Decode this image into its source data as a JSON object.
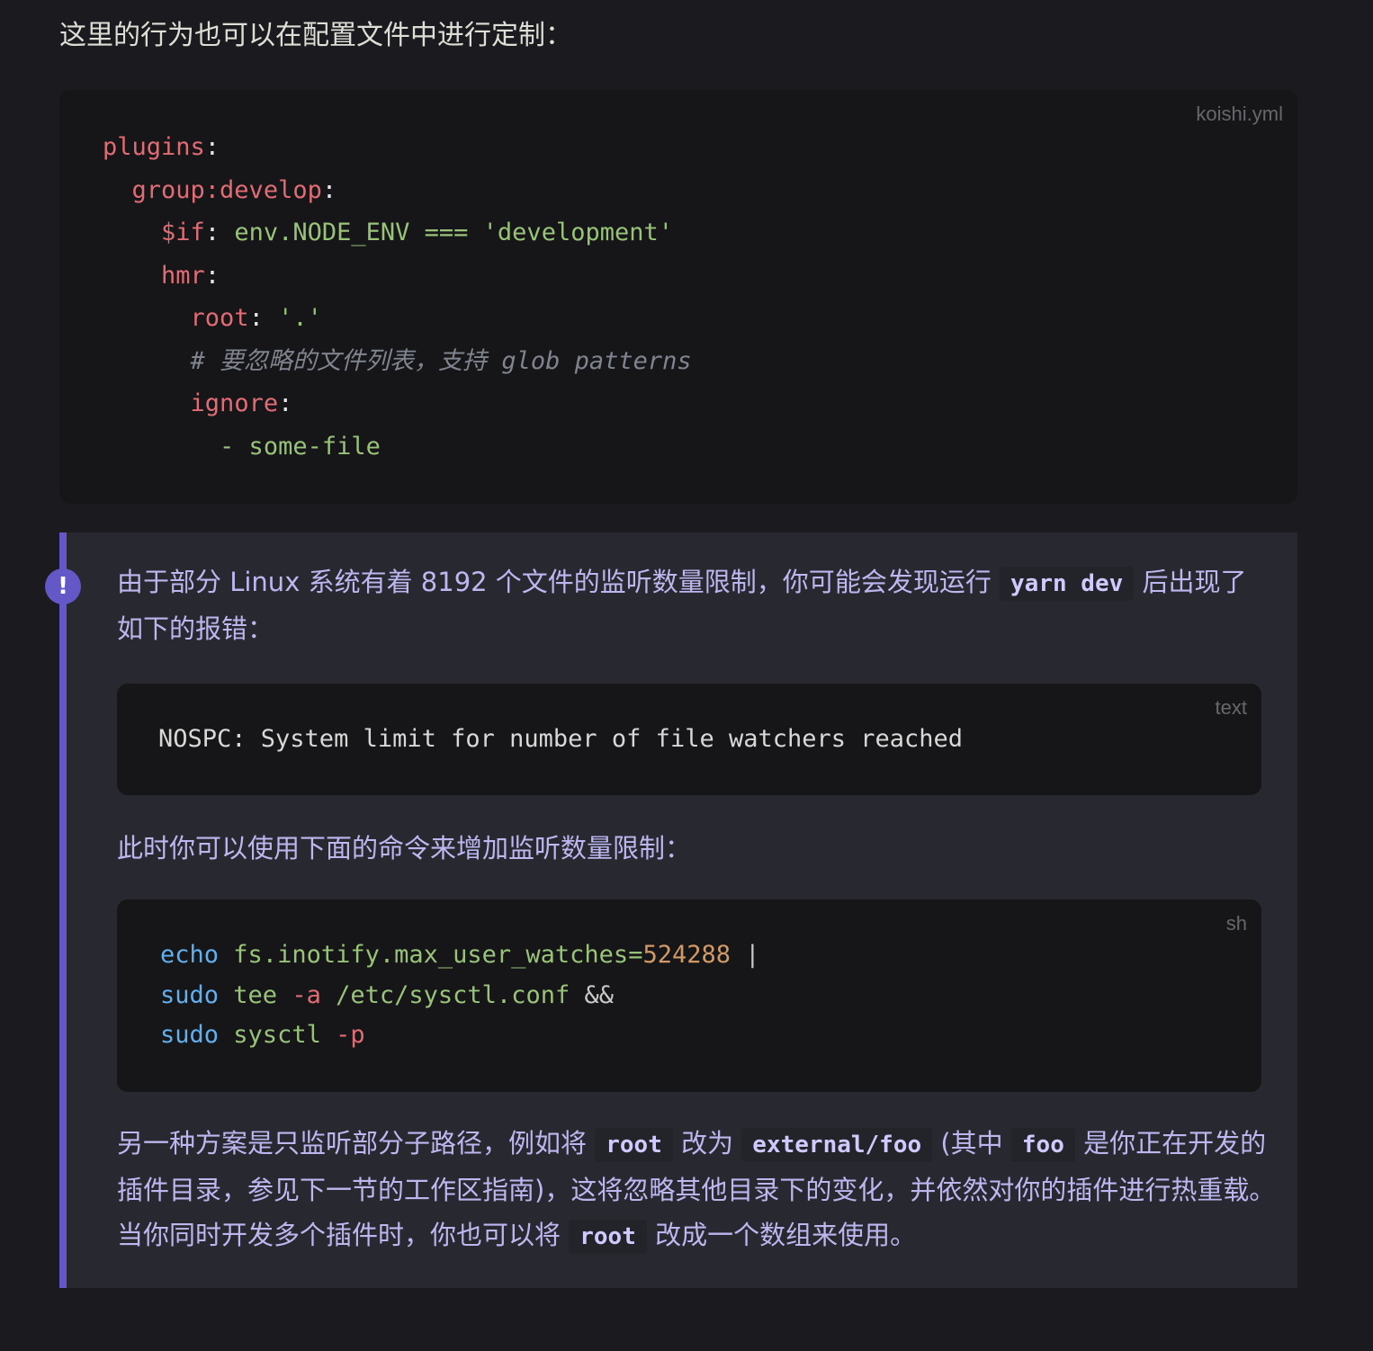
{
  "intro_text": "这里的行为也可以在配置文件中进行定制：",
  "yaml_block": {
    "lang": "koishi.yml",
    "lines": {
      "l1_key": "plugins",
      "l2_key": "group:develop",
      "l3_key": "$if",
      "l3_value": "env.NODE_ENV === 'development'",
      "l4_key": "hmr",
      "l5_key": "root",
      "l5_value": "'.'",
      "l6_comment": "# 要忽略的文件列表，支持 glob patterns",
      "l7_key": "ignore",
      "l8_value": "- some-file"
    }
  },
  "tip": {
    "icon": "!",
    "p1_before": "由于部分 Linux 系统有着 8192 个文件的监听数量限制，你可能会发现运行 ",
    "p1_code": "yarn dev",
    "p1_after": " 后出现了如下的报错：",
    "text_block": {
      "lang": "text",
      "line": "NOSPC: System limit for number of file watchers reached"
    },
    "p2": "此时你可以使用下面的命令来增加监听数量限制：",
    "sh_block": {
      "lang": "sh",
      "l1_cmd": "echo",
      "l1_arg": "fs.inotify.max_user_watches=",
      "l1_num": "524288",
      "l1_op": "|",
      "l2_cmd": "sudo",
      "l2_arg1": "tee",
      "l2_flag": "-a",
      "l2_arg2": "/etc/sysctl.conf",
      "l2_op": "&&",
      "l3_cmd": "sudo",
      "l3_arg": "sysctl",
      "l3_flag": "-p"
    },
    "p3_part1": "另一种方案是只监听部分子路径，例如将 ",
    "p3_code1": "root",
    "p3_part2": " 改为 ",
    "p3_code2": "external/foo",
    "p3_part3": " (其中 ",
    "p3_code3": "foo",
    "p3_part4": " 是你正在开发的插件目录，参见下一节的工作区指南)，这将忽略其他目录下的变化，并依然对你的插件进行热重载。当你同时开发多个插件时，你也可以将 ",
    "p3_code4": "root",
    "p3_part5": " 改成一个数组来使用。"
  }
}
